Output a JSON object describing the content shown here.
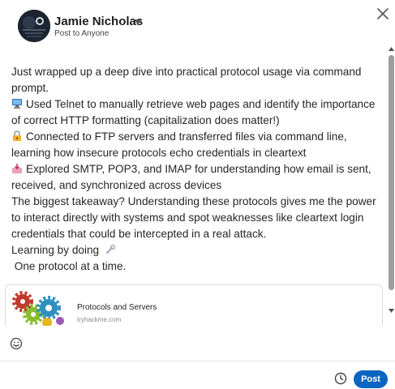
{
  "author": {
    "name": "Jamie Nicholas",
    "visibility": "Post to Anyone"
  },
  "post": {
    "lines": [
      "Just wrapped up a deep dive into practical protocol usage via command prompt.",
      "Used Telnet to manually retrieve web pages and identify the importance of correct HTTP formatting (capitalization does matter!)",
      "Connected to FTP servers and transferred files via command line, learning how insecure protocols echo credentials in cleartext",
      "Explored SMTP, POP3, and IMAP for understanding how email is sent, received, and synchronized across devices",
      "The biggest takeaway? Understanding these protocols gives me the power to interact directly with systems and spot weaknesses like cleartext login credentials that could be intercepted in a real attack.",
      "Learning by doing",
      " One protocol at a time."
    ],
    "icons": [
      "computer-icon",
      "lock-icon",
      "inbox-icon",
      "wrench-icon"
    ]
  },
  "link_preview": {
    "title": "Protocols and Servers",
    "domain": "tryhackme.com"
  },
  "footer": {
    "post_label": "Post"
  },
  "colors": {
    "accent": "#0a66c2",
    "text": "#262626"
  }
}
